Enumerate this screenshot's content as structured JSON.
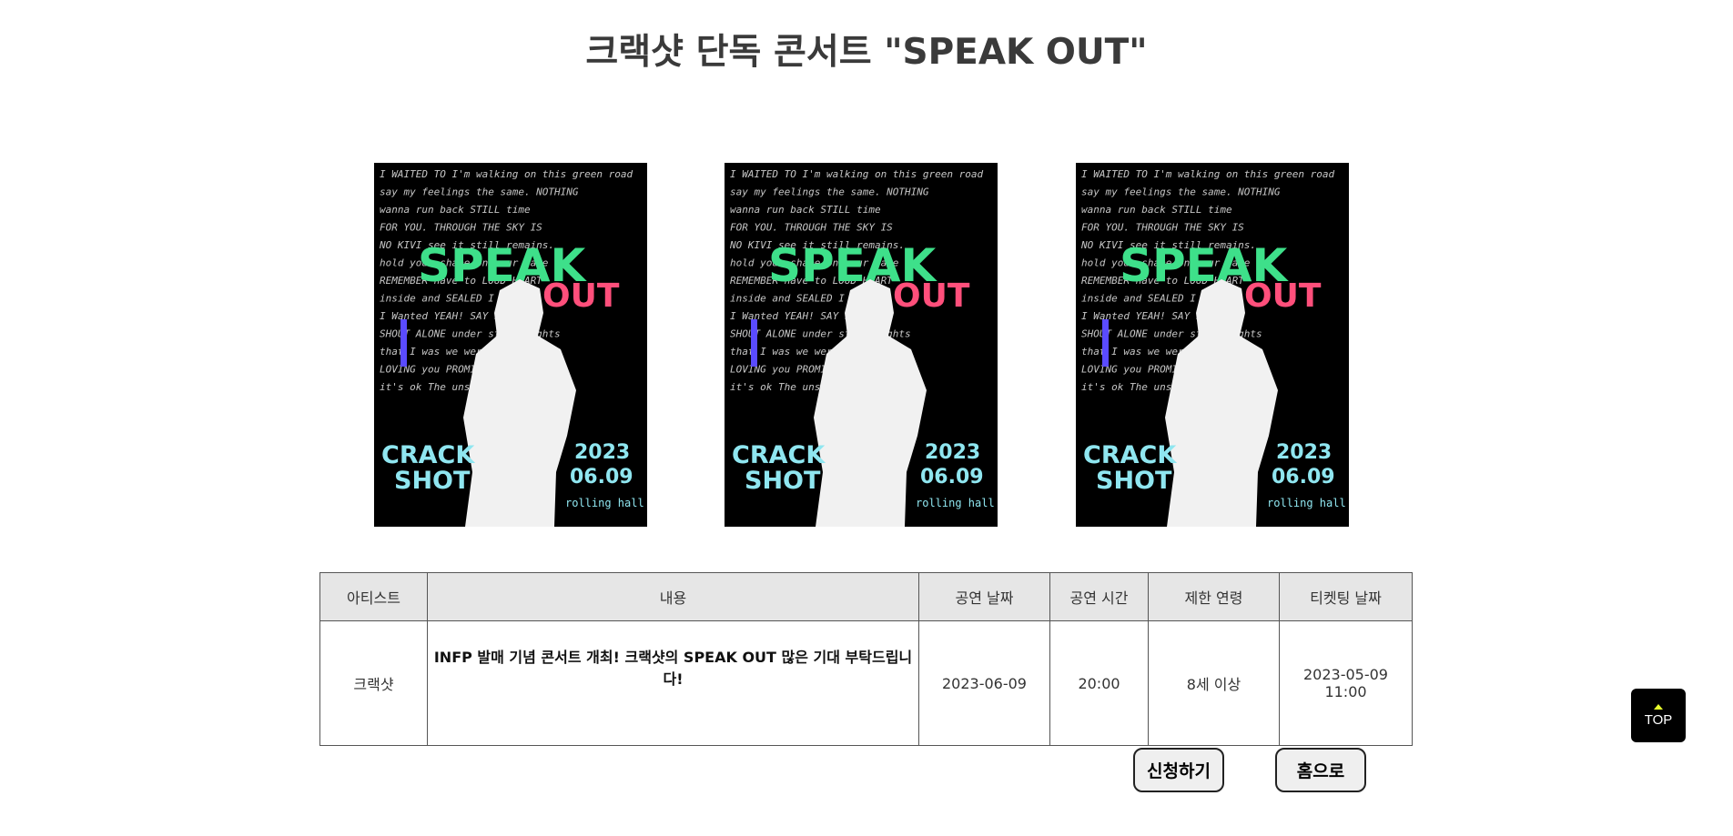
{
  "page": {
    "title": "크랙샷 단독 콘서트 \"SPEAK OUT\""
  },
  "poster": {
    "headline_top": "SPEAK",
    "headline_bottom": "OUT",
    "artist_line1": "CRACK",
    "artist_line2": "SHOT",
    "year": "2023",
    "date": "06.09",
    "venue": "rolling hall",
    "texture_lines": [
      "I WAITED TO   I'm walking on this green road",
      "say my feelings   the same.   NOTHING",
      "wanna run back   STILL   time",
      "FOR YOU.   THROUGH THE SKY IS",
      "NO KIVI  see it still remains.",
      "hold your   shape on your face",
      "REMEMBER   have to  LOUD   HEART",
      "inside and   SEALED   I still",
      "I Wanted   YEAH!   SAY  FEELING",
      "SHOUT   ALONE   under streetlights",
      "that I was   we were  NEHW",
      "LOVING   you   PROMISE",
      "it's ok   The   unsent texts"
    ],
    "colors": {
      "speak": "#3ee08a",
      "out": "#ff4f7b",
      "cyan": "#8fe6f0",
      "blue": "#5a4bff",
      "texture": "#e8e8e8"
    }
  },
  "table": {
    "headers": [
      "아티스트",
      "내용",
      "공연 날짜",
      "공연 시간",
      "제한 연령",
      "티켓팅 날짜"
    ],
    "row": {
      "artist": "크랙샷",
      "content": "INFP 발매 기념 콘서트 개최! 크랙샷의 SPEAK OUT 많은 기대 부탁드립니다!",
      "date": "2023-06-09",
      "time": "20:00",
      "age": "8세 이상",
      "ticketing": "2023-05-09 11:00"
    }
  },
  "buttons": {
    "apply": "신청하기",
    "home": "홈으로",
    "top": "TOP"
  }
}
